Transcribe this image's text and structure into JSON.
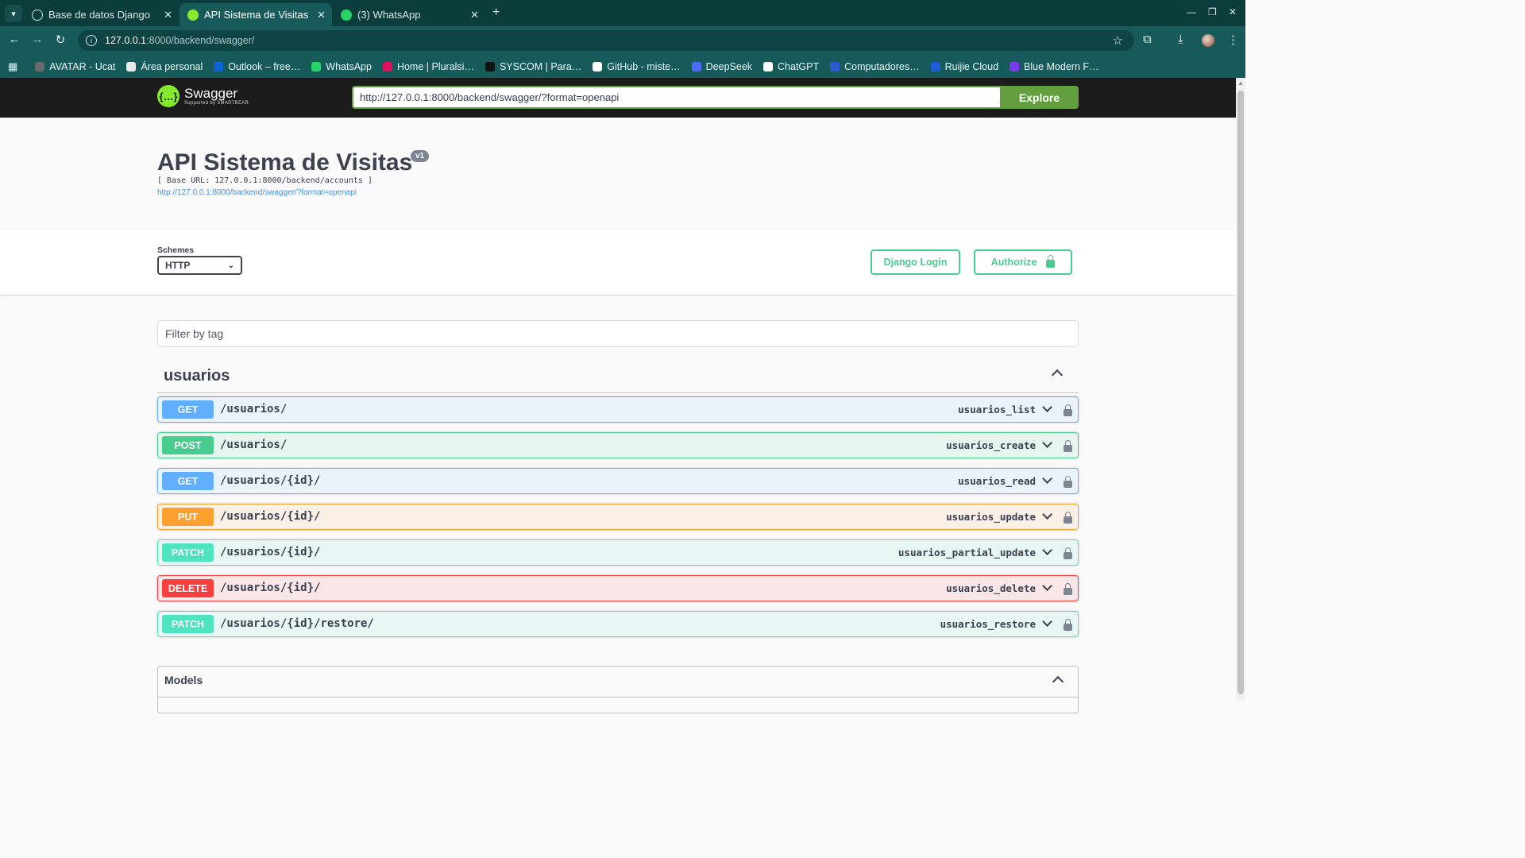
{
  "browser": {
    "tabs": [
      {
        "title": "Base de datos Django",
        "active": false
      },
      {
        "title": "API Sistema de Visitas",
        "active": true
      },
      {
        "title": "(3) WhatsApp",
        "active": false
      }
    ],
    "address": {
      "host": "127.0.0.1",
      "path": ":8000/backend/swagger/"
    },
    "bookmarks": [
      {
        "label": "AVATAR - Ucat",
        "color": "#6a6a6a"
      },
      {
        "label": "Área personal",
        "color": "#e8e8e8"
      },
      {
        "label": "Outlook – free…",
        "color": "#0a64d6"
      },
      {
        "label": "WhatsApp",
        "color": "#25d366"
      },
      {
        "label": "Home | Pluralsi…",
        "color": "#e0115f"
      },
      {
        "label": "SYSCOM | Para…",
        "color": "#111111"
      },
      {
        "label": "GitHub - miste…",
        "color": "#ffffff"
      },
      {
        "label": "DeepSeek",
        "color": "#4d6bfe"
      },
      {
        "label": "ChatGPT",
        "color": "#ffffff"
      },
      {
        "label": "Computadores…",
        "color": "#2a5ad1"
      },
      {
        "label": "Ruijie Cloud",
        "color": "#1c5cd8"
      },
      {
        "label": "Blue Modern F…",
        "color": "#7c3aed"
      }
    ]
  },
  "swagger": {
    "logo": {
      "brand": "Swagger",
      "sub": "Supported by SMARTBEAR"
    },
    "spec_url": "http://127.0.0.1:8000/backend/swagger/?format=openapi",
    "explore_label": "Explore",
    "title": "API Sistema de Visitas",
    "version": "v1",
    "base_url": "[ Base URL: 127.0.0.1:8000/backend/accounts ]",
    "spec_link": "http://127.0.0.1:8000/backend/swagger/?format=openapi",
    "schemes_label": "Schemes",
    "scheme_selected": "HTTP",
    "django_login_label": "Django Login",
    "authorize_label": "Authorize",
    "filter_placeholder": "Filter by tag",
    "tag": "usuarios",
    "operations": [
      {
        "method": "GET",
        "path": "/usuarios/",
        "id": "usuarios_list"
      },
      {
        "method": "POST",
        "path": "/usuarios/",
        "id": "usuarios_create"
      },
      {
        "method": "GET",
        "path": "/usuarios/{id}/",
        "id": "usuarios_read"
      },
      {
        "method": "PUT",
        "path": "/usuarios/{id}/",
        "id": "usuarios_update"
      },
      {
        "method": "PATCH",
        "path": "/usuarios/{id}/",
        "id": "usuarios_partial_update"
      },
      {
        "method": "DELETE",
        "path": "/usuarios/{id}/",
        "id": "usuarios_delete"
      },
      {
        "method": "PATCH",
        "path": "/usuarios/{id}/restore/",
        "id": "usuarios_restore"
      }
    ],
    "models_label": "Models"
  },
  "colors": {
    "get": "#61affe",
    "post": "#49cc90",
    "put": "#fca130",
    "patch": "#50e3c2",
    "delete": "#f93e3e",
    "chrome": "#175a5a"
  }
}
